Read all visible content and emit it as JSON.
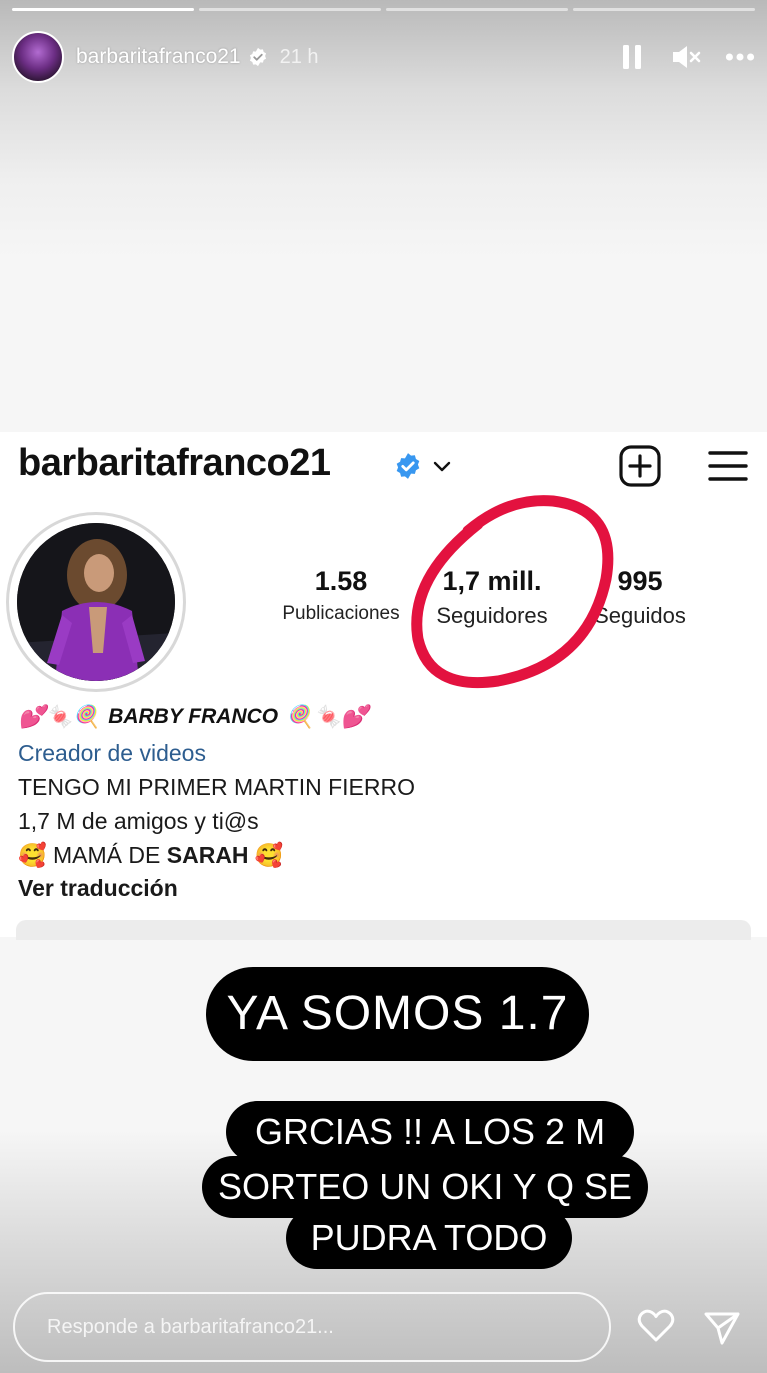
{
  "story": {
    "progress": [
      1,
      0,
      0,
      0
    ],
    "username": "barbaritafranco21",
    "time": "21 h",
    "icons": {
      "verified": "verified-badge-icon",
      "pause": "pause-icon",
      "mute": "mute-icon",
      "more": "more-icon"
    }
  },
  "profile": {
    "handle": "barbaritafranco21",
    "stats": [
      {
        "num": "1.58",
        "label": "Publicaciones"
      },
      {
        "num": "1,7 mill.",
        "label": "Seguidores"
      },
      {
        "num": "995",
        "label": "Seguidos"
      }
    ],
    "bio": {
      "name": "BARBY FRANCO",
      "name_emoji_left": "💕🍬🍭",
      "name_emoji_right": "🍭🍬💕",
      "category": "Creador de videos",
      "line1": "TENGO MI PRIMER MARTIN FIERRO",
      "line2": "1,7 M de amigos y ti@s",
      "line3_prefix": "🥰 MAMÁ DE ",
      "line3_strong": "SARAH",
      "line3_suffix": " 🥰",
      "translate": "Ver traducción"
    },
    "colors": {
      "verified": "#3897f0",
      "link": "#2d5d8f",
      "circle_mark": "#e3123f"
    }
  },
  "stickers": {
    "main": "YA SOMOS 1.7",
    "line1": "GRCIAS !! A LOS 2 M",
    "line2": "SORTEO UN OKI Y Q SE",
    "line3": "PUDRA TODO"
  },
  "reply": {
    "placeholder": "Responde a barbaritafranco21...",
    "icons": {
      "like": "heart-icon",
      "send": "send-icon"
    }
  }
}
